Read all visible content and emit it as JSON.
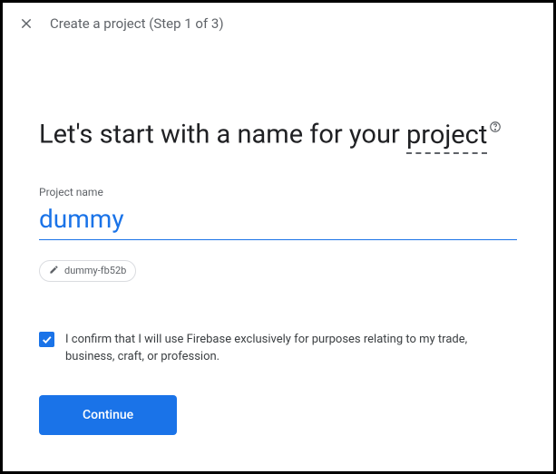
{
  "header": {
    "title": "Create a project (Step 1 of 3)"
  },
  "headline": {
    "part1": "Let's start with a name for your ",
    "underlined": "project"
  },
  "field": {
    "label": "Project name",
    "value": "dummy"
  },
  "chip": {
    "id": "dummy-fb52b"
  },
  "confirm": {
    "checked": true,
    "text": "I confirm that I will use Firebase exclusively for purposes relating to my trade, business, craft, or profession."
  },
  "buttons": {
    "continue": "Continue"
  }
}
